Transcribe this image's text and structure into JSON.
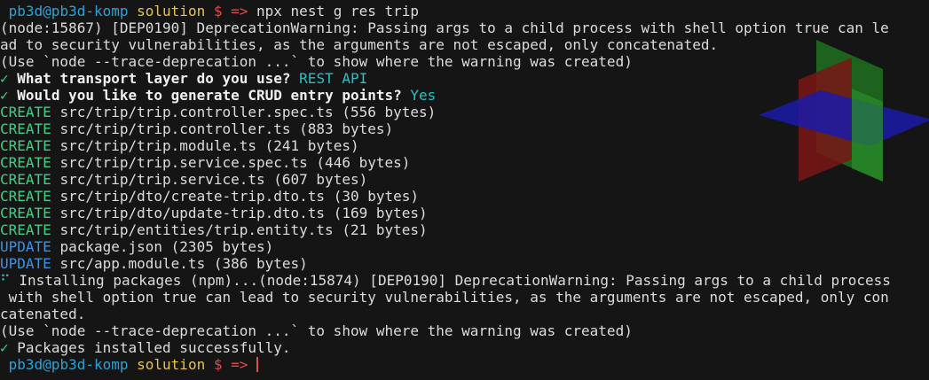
{
  "prompt": {
    "user_host": "pb3d@pb3d-komp",
    "dir": "solution",
    "symbols": "$ =>"
  },
  "lines": {
    "cmd": "npx nest g res trip",
    "warn1a": "(node:15867) [DEP0190] DeprecationWarning: Passing args to a child process with shell option true can le",
    "warn1b": "ad to security vulnerabilities, as the arguments are not escaped, only concatenated.",
    "trace1": "(Use `node --trace-deprecation ...` to show where the warning was created)",
    "q1_mark": "✓",
    "q1_text": "What transport layer do you use?",
    "q1_answer": "REST API",
    "q2_mark": "✓",
    "q2_text": "Would you like to generate CRUD entry points?",
    "q2_answer": "Yes",
    "install_spinner": "⠋",
    "install_text": "Installing packages (npm)...(node:15874) [DEP0190] DeprecationWarning: Passing args to a child process",
    "install_b": " with shell option true can lead to security vulnerabilities, as the arguments are not escaped, only con",
    "install_c": "catenated.",
    "trace2": "(Use `node --trace-deprecation ...` to show where the warning was created)",
    "done_mark": "✓",
    "done_text": "Packages installed successfully."
  },
  "files": [
    {
      "action": "CREATE",
      "path": "src/trip/trip.controller.spec.ts (556 bytes)"
    },
    {
      "action": "CREATE",
      "path": "src/trip/trip.controller.ts (883 bytes)"
    },
    {
      "action": "CREATE",
      "path": "src/trip/trip.module.ts (241 bytes)"
    },
    {
      "action": "CREATE",
      "path": "src/trip/trip.service.spec.ts (446 bytes)"
    },
    {
      "action": "CREATE",
      "path": "src/trip/trip.service.ts (607 bytes)"
    },
    {
      "action": "CREATE",
      "path": "src/trip/dto/create-trip.dto.ts (30 bytes)"
    },
    {
      "action": "CREATE",
      "path": "src/trip/dto/update-trip.dto.ts (169 bytes)"
    },
    {
      "action": "CREATE",
      "path": "src/trip/entities/trip.entity.ts (21 bytes)"
    },
    {
      "action": "UPDATE",
      "path": "package.json (2305 bytes)"
    },
    {
      "action": "UPDATE",
      "path": "src/app.module.ts (386 bytes)"
    }
  ],
  "colors": {
    "background": "#151515",
    "user": "#2aa4d6",
    "dir": "#e8c547",
    "prompt_symbol": "#e84a4a",
    "create": "#3fd086",
    "update": "#3a93e8",
    "answer": "#2bbfc4"
  }
}
